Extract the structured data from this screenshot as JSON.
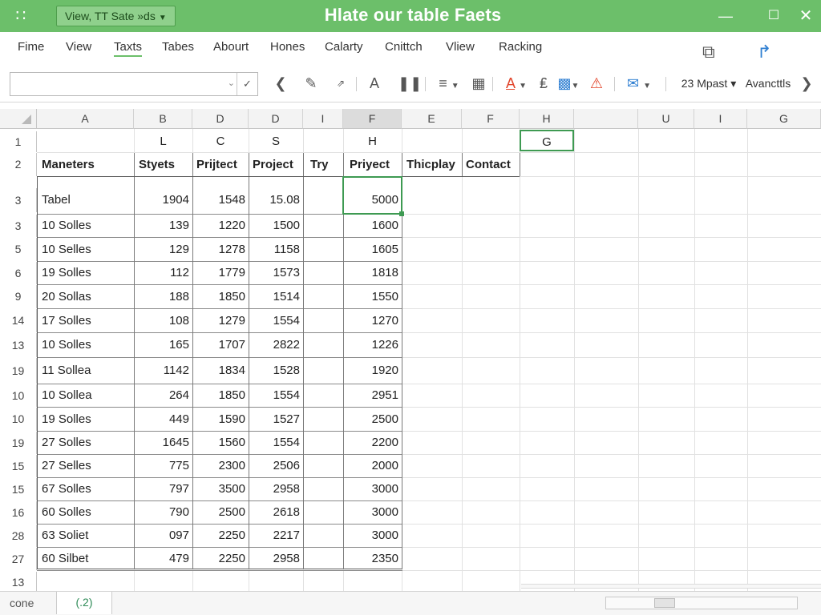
{
  "titlebar": {
    "qat_label": "View, TT Sate »ds",
    "title": "Hlate our table Faets"
  },
  "menu": [
    "Fime",
    "View",
    "Taxts",
    "Tabes",
    "Abourt",
    "Hones",
    "Calarty",
    "Cnittch",
    "Vliew",
    "Racking"
  ],
  "toolbar": {
    "mpast_label": "23 Mpast ▾",
    "avancts_label": "Avancttls"
  },
  "columns": [
    "A",
    "B",
    "D",
    "D",
    "I",
    "F",
    "E",
    "F",
    "H",
    "",
    "U",
    "I",
    "G"
  ],
  "row_numbers": [
    "1",
    "2",
    "3",
    "3",
    "5",
    "6",
    "9",
    "14",
    "13",
    "19",
    "10",
    "10",
    "19",
    "15",
    "15",
    "16",
    "28",
    "27",
    "13"
  ],
  "row1_letters": [
    "L",
    "C",
    "S",
    "H",
    "G"
  ],
  "table_headers": [
    "Maneters",
    "Styets",
    "Prijtect",
    "Project",
    "Try",
    "Priyect",
    "Thicplay",
    "Contact"
  ],
  "table_rows": [
    [
      "Tabel",
      "1904",
      "1548",
      "15.08",
      "",
      "5000"
    ],
    [
      "10 Solles",
      "139",
      "1220",
      "1500",
      "",
      "1600"
    ],
    [
      "10 Selles",
      "129",
      "1278",
      "1158",
      "",
      "1605"
    ],
    [
      "19 Solles",
      "112",
      "1779",
      "1573",
      "",
      "1818"
    ],
    [
      "20 Sollas",
      "188",
      "1850",
      "1514",
      "",
      "1550"
    ],
    [
      "17 Solles",
      "108",
      "1279",
      "1554",
      "",
      "1270"
    ],
    [
      "10 Solles",
      "165",
      "1707",
      "2822",
      "",
      "1226"
    ],
    [
      "11 Sollea",
      "1142",
      "1834",
      "1528",
      "",
      "1920"
    ],
    [
      "10 Sollea",
      "264",
      "1850",
      "1554",
      "",
      "2951"
    ],
    [
      "19 Solles",
      "449",
      "1590",
      "1527",
      "",
      "2500"
    ],
    [
      "27 Solles",
      "1645",
      "1560",
      "1554",
      "",
      "2200"
    ],
    [
      "27 Selles",
      "775",
      "2300",
      "2506",
      "",
      "2000"
    ],
    [
      "67 Solles",
      "797",
      "3500",
      "2958",
      "",
      "3000"
    ],
    [
      "60 Solles",
      "790",
      "2500",
      "2618",
      "",
      "3000"
    ],
    [
      "63 Soliet",
      "097",
      "2250",
      "2217",
      "",
      "3000"
    ],
    [
      "60 Silbet",
      "479",
      "2250",
      "2958",
      "",
      "2350"
    ]
  ],
  "status": {
    "mode": "cone",
    "sheet_tab": "(.2)"
  }
}
